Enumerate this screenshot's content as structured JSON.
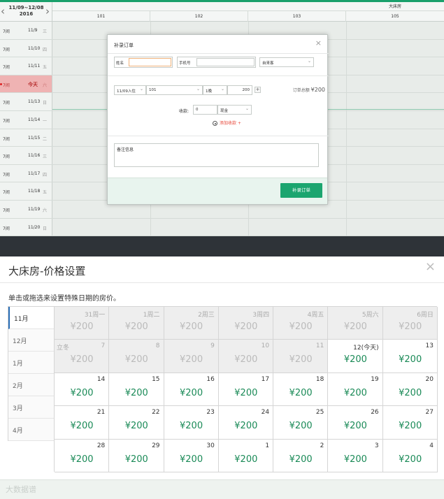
{
  "booking_grid": {
    "date_range": "11/09~12/08",
    "year": "2016",
    "room_group": "大床房",
    "rooms": [
      "101",
      "102",
      "103",
      "105"
    ],
    "days": [
      {
        "pre": "7间",
        "date": "11/9",
        "weekday": "三"
      },
      {
        "pre": "7间",
        "date": "11/10",
        "weekday": "四"
      },
      {
        "pre": "7间",
        "date": "11/11",
        "weekday": "五"
      },
      {
        "pre": "7间",
        "date": "今天",
        "weekday": "六",
        "today": true
      },
      {
        "pre": "7间",
        "date": "11/13",
        "weekday": "日"
      },
      {
        "pre": "7间",
        "date": "11/14",
        "weekday": "一"
      },
      {
        "pre": "7间",
        "date": "11/15",
        "weekday": "二"
      },
      {
        "pre": "7间",
        "date": "11/16",
        "weekday": "三"
      },
      {
        "pre": "7间",
        "date": "11/17",
        "weekday": "四"
      },
      {
        "pre": "7间",
        "date": "11/18",
        "weekday": "五"
      },
      {
        "pre": "7间",
        "date": "11/19",
        "weekday": "六"
      },
      {
        "pre": "7间",
        "date": "11/20",
        "weekday": "日"
      }
    ]
  },
  "modal": {
    "title": "补录订单",
    "name_label": "姓名",
    "phone_label": "手机号",
    "source_value": "自来客",
    "checkin_value": "11/09入住",
    "room_value": "101",
    "nights_value": "1晚",
    "price_value": "200",
    "total_label": "订单总额",
    "total_value": "¥200",
    "payment_label": "收款:",
    "payment_amount": "0",
    "payment_method": "现金",
    "add_payment": "添加收款 +",
    "remark_placeholder": "备注信息",
    "submit_label": "补录订单"
  },
  "price_panel": {
    "title": "大床房-价格设置",
    "hint": "单击或拖选来设置特殊日期的房价。",
    "months": [
      "11月",
      "12月",
      "1月",
      "2月",
      "3月",
      "4月"
    ],
    "active_month": "11月",
    "cells": [
      {
        "d": "31周一",
        "p": "¥200",
        "past": true
      },
      {
        "d": "1周二",
        "p": "¥200",
        "past": true
      },
      {
        "d": "2周三",
        "p": "¥200",
        "past": true
      },
      {
        "d": "3周四",
        "p": "¥200",
        "past": true
      },
      {
        "d": "4周五",
        "p": "¥200",
        "past": true
      },
      {
        "d": "5周六",
        "p": "¥200",
        "past": true
      },
      {
        "d": "6周日",
        "p": "¥200",
        "past": true
      },
      {
        "d": "7",
        "t": "立冬",
        "p": "¥200",
        "past": true
      },
      {
        "d": "8",
        "p": "¥200",
        "past": true
      },
      {
        "d": "9",
        "p": "¥200",
        "past": true
      },
      {
        "d": "10",
        "p": "¥200",
        "past": true
      },
      {
        "d": "11",
        "p": "¥200",
        "past": true
      },
      {
        "d": "12(今天)",
        "p": "¥200"
      },
      {
        "d": "13",
        "p": "¥200"
      },
      {
        "d": "14",
        "p": "¥200"
      },
      {
        "d": "15",
        "p": "¥200"
      },
      {
        "d": "16",
        "p": "¥200"
      },
      {
        "d": "17",
        "p": "¥200"
      },
      {
        "d": "18",
        "p": "¥200"
      },
      {
        "d": "19",
        "p": "¥200"
      },
      {
        "d": "20",
        "p": "¥200"
      },
      {
        "d": "21",
        "p": "¥200"
      },
      {
        "d": "22",
        "p": "¥200"
      },
      {
        "d": "23",
        "p": "¥200"
      },
      {
        "d": "24",
        "p": "¥200"
      },
      {
        "d": "25",
        "p": "¥200"
      },
      {
        "d": "26",
        "p": "¥200"
      },
      {
        "d": "27",
        "p": "¥200"
      },
      {
        "d": "28",
        "p": "¥200"
      },
      {
        "d": "29",
        "p": "¥200"
      },
      {
        "d": "30",
        "p": "¥200"
      },
      {
        "d": "1",
        "p": "¥200"
      },
      {
        "d": "2",
        "p": "¥200"
      },
      {
        "d": "3",
        "p": "¥200"
      },
      {
        "d": "4",
        "p": "¥200"
      }
    ],
    "watermark": "大数据谱"
  },
  "colors": {
    "accent_green": "#1ba56f",
    "price_green": "#1a8a57",
    "today_red": "#efb3b3"
  }
}
